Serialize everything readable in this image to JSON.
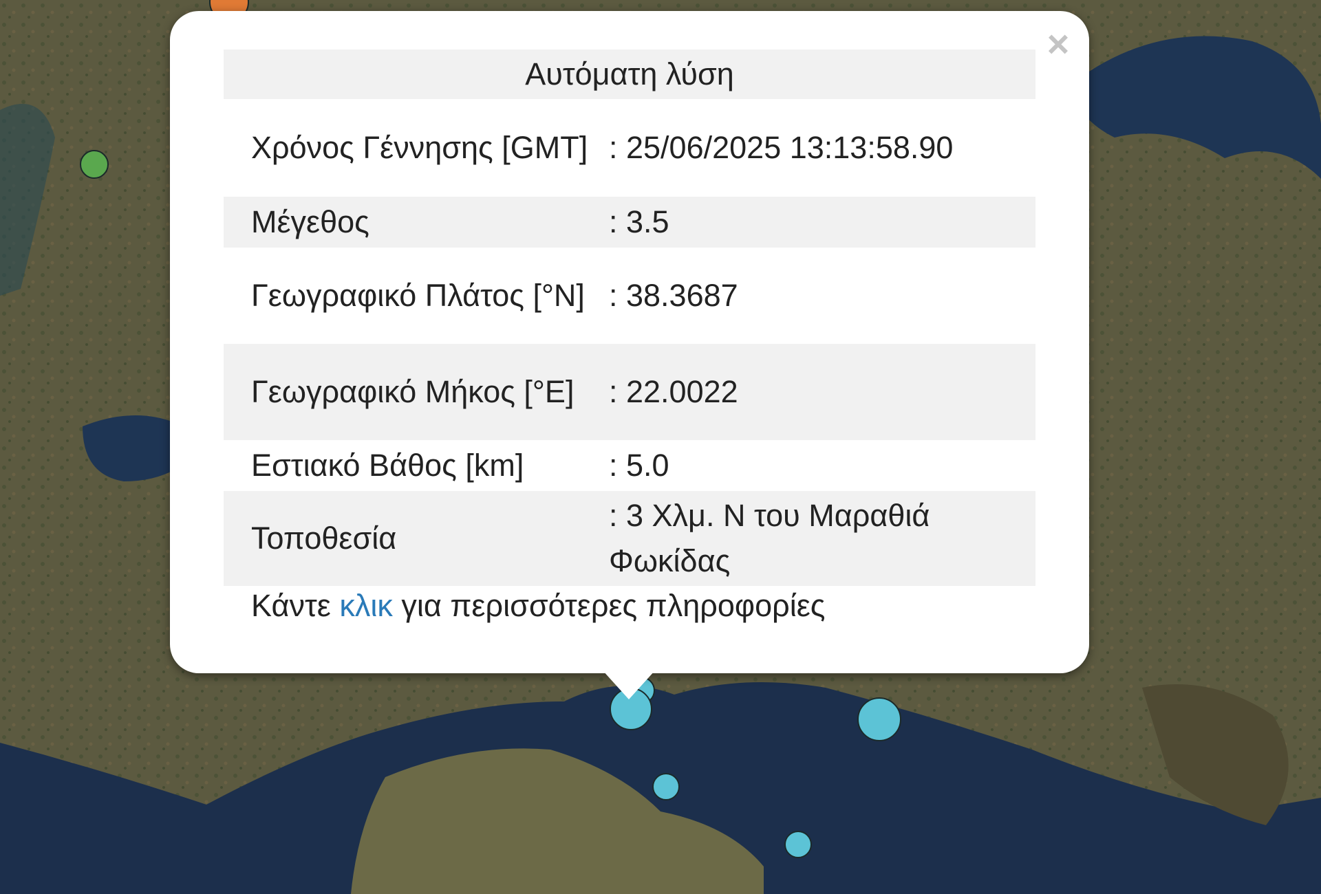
{
  "popup": {
    "title": "Αυτόματη λύση",
    "rows": [
      {
        "label": "Χρόνος Γέννησης [GMT]",
        "value": ": 25/06/2025 13:13:58.90"
      },
      {
        "label": "Μέγεθος",
        "value": ": 3.5"
      },
      {
        "label": "Γεωγραφικό Πλάτος [°N]",
        "value": ": 38.3687"
      },
      {
        "label": "Γεωγραφικό Μήκος [°E]",
        "value": ": 22.0022"
      },
      {
        "label": "Εστιακό Βάθος [km]",
        "value": ": 5.0"
      },
      {
        "label": "Τοποθεσία",
        "value": ": 3 Χλμ. Ν του Μαραθιά Φωκίδας"
      }
    ],
    "footer_prefix": "Κάντε",
    "footer_link": "κλικ",
    "footer_suffix": "για περισσότερες πληροφορίες",
    "close_label": "×"
  },
  "map": {
    "marker_colors": {
      "recent": "#e07a35",
      "older": "#5aa84e",
      "automatic": "#5cc3d6"
    },
    "markers": [
      {
        "type": "recent",
        "label": "orange-marker"
      },
      {
        "type": "older",
        "label": "green-marker"
      },
      {
        "type": "automatic",
        "label": "selected-event-marker"
      },
      {
        "type": "automatic",
        "label": "event-marker"
      },
      {
        "type": "automatic",
        "label": "event-marker"
      },
      {
        "type": "automatic",
        "label": "event-marker"
      },
      {
        "type": "automatic",
        "label": "event-marker"
      }
    ]
  }
}
